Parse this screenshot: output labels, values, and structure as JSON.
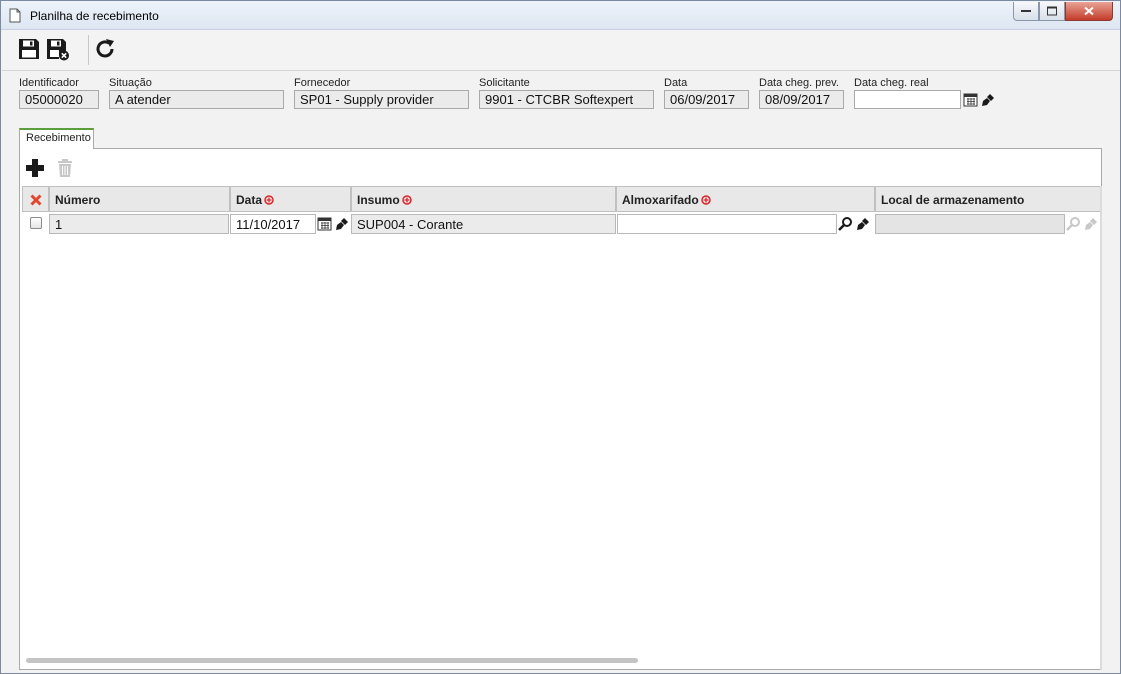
{
  "window": {
    "title": "Planilha de recebimento",
    "title_icon": "document-icon"
  },
  "toolbar": {
    "buttons": [
      {
        "name": "save-icon",
        "label": "Salvar"
      },
      {
        "name": "save-close-icon",
        "label": "Salvar e fechar"
      },
      {
        "name": "refresh-icon",
        "label": "Atualizar"
      }
    ]
  },
  "form": {
    "identificador": {
      "label": "Identificador",
      "value": "05000020"
    },
    "situacao": {
      "label": "Situação",
      "value": "A atender"
    },
    "fornecedor": {
      "label": "Fornecedor",
      "value": "SP01 - Supply provider"
    },
    "solicitante": {
      "label": "Solicitante",
      "value": "9901 - CTCBR Softexpert"
    },
    "data": {
      "label": "Data",
      "value": "06/09/2017"
    },
    "data_cheg_prev": {
      "label": "Data cheg. prev.",
      "value": "08/09/2017"
    },
    "data_cheg_real": {
      "label": "Data cheg. real",
      "value": ""
    }
  },
  "tab": {
    "label": "Recebimento"
  },
  "grid": {
    "columns": [
      "Número",
      "Data",
      "Insumo",
      "Almoxarifado",
      "Local de armazenamento"
    ],
    "required_columns": [
      "Data",
      "Insumo",
      "Almoxarifado"
    ],
    "rows": [
      {
        "numero": "1",
        "data": "11/10/2017",
        "insumo": "SUP004 - Corante",
        "almoxarifado": "",
        "local": ""
      }
    ]
  },
  "colors": {
    "required_marker": "#d9262b",
    "delete_marker": "#e2462c",
    "tab_accent": "#5b9e3b"
  }
}
